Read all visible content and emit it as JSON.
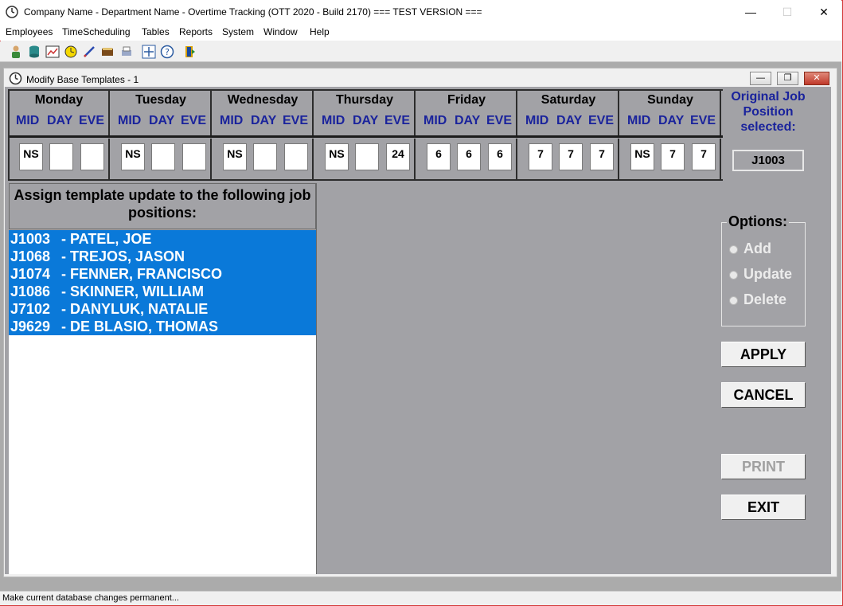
{
  "window": {
    "title": "Company Name - Department Name - Overtime Tracking (OTT 2020 - Build 2170)  === TEST VERSION ===",
    "minimize": "—",
    "maximize": "☐",
    "close": "✕"
  },
  "menu": [
    "Employees",
    "TimeScheduling",
    "Tables",
    "Reports",
    "System",
    "Window",
    "Help"
  ],
  "child": {
    "title": "Modify Base Templates - 1",
    "min": "—",
    "max": "❐",
    "close": "✕"
  },
  "shift_labels": [
    "MID",
    "DAY",
    "EVE"
  ],
  "days": [
    {
      "name": "Monday",
      "values": [
        "NS",
        "",
        ""
      ]
    },
    {
      "name": "Tuesday",
      "values": [
        "NS",
        "",
        ""
      ]
    },
    {
      "name": "Wednesday",
      "values": [
        "NS",
        "",
        ""
      ]
    },
    {
      "name": "Thursday",
      "values": [
        "NS",
        "",
        "24"
      ]
    },
    {
      "name": "Friday",
      "values": [
        "6",
        "6",
        "6"
      ]
    },
    {
      "name": "Saturday",
      "values": [
        "7",
        "7",
        "7"
      ]
    },
    {
      "name": "Sunday",
      "values": [
        "NS",
        "7",
        "7"
      ]
    }
  ],
  "original_job": {
    "label": "Original Job Position selected:",
    "value": "J1003"
  },
  "assign_header": "Assign template update to the following job positions:",
  "jobs": [
    {
      "id": "J1003",
      "name": "- PATEL, JOE"
    },
    {
      "id": "J1068",
      "name": "- TREJOS, JASON"
    },
    {
      "id": "J1074",
      "name": "- FENNER, FRANCISCO"
    },
    {
      "id": "J1086",
      "name": "- SKINNER, WILLIAM"
    },
    {
      "id": "J7102",
      "name": "- DANYLUK, NATALIE"
    },
    {
      "id": "J9629",
      "name": "- DE BLASIO, THOMAS"
    }
  ],
  "options": {
    "legend": "Options:",
    "items": [
      "Add",
      "Update",
      "Delete"
    ]
  },
  "buttons": {
    "apply": "APPLY",
    "cancel": "CANCEL",
    "print": "PRINT",
    "exit": "EXIT"
  },
  "status": "Make current database changes permanent..."
}
